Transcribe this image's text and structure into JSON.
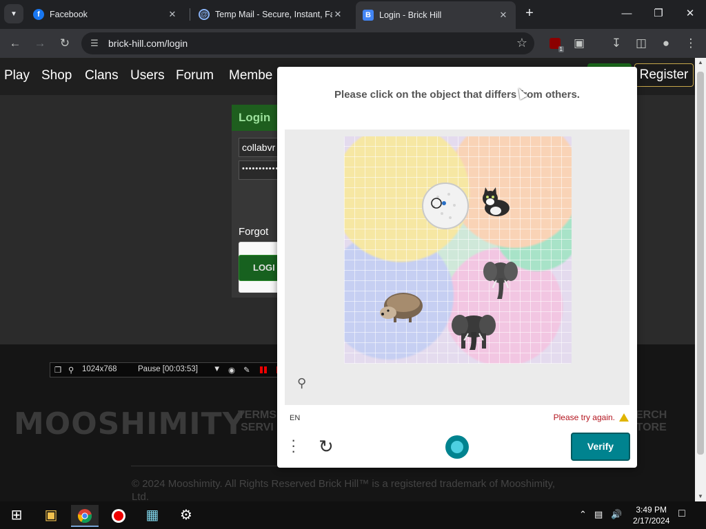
{
  "browser": {
    "tabs": [
      {
        "title": "Facebook",
        "icon": "facebook-icon",
        "color": "#1877f2"
      },
      {
        "title": "Temp Mail - Secure, Instant, Fas",
        "icon": "tempmail-icon",
        "color": "#8ab4f8"
      },
      {
        "title": "Login - Brick Hill",
        "icon": "brickhill-icon",
        "color": "#4285f4",
        "active": true
      }
    ],
    "url": "brick-hill.com/login",
    "new_tab": "+",
    "extension_badge": "1"
  },
  "site": {
    "nav": [
      "Play",
      "Shop",
      "Clans",
      "Users",
      "Forum",
      "Membe"
    ],
    "register": "Register",
    "login": {
      "heading": "Login",
      "username": "collabvr",
      "password": "••••••••••••",
      "forgot": "Forgot",
      "button": "LOGI"
    },
    "footer": {
      "logo": "MOOSHIMITY",
      "terms": [
        "TERMS",
        "SERVI"
      ],
      "merch": [
        "ERCH",
        "TORE"
      ],
      "copyright": "© 2024 Mooshimity. All Rights Reserved Brick Hill™ is a registered trademark of Mooshimity, Ltd."
    }
  },
  "recorder": {
    "resolution": "1024x768",
    "status": "Pause [00:03:53]"
  },
  "captcha": {
    "prompt": "Please click on the object that differs from others.",
    "language": "EN",
    "error": "Please try again.",
    "verify": "Verify",
    "objects": [
      "golf-ball",
      "cat",
      "elephant",
      "hedgehog",
      "elephant"
    ]
  },
  "taskbar": {
    "time": "3:49 PM",
    "date": "2/17/2024"
  }
}
